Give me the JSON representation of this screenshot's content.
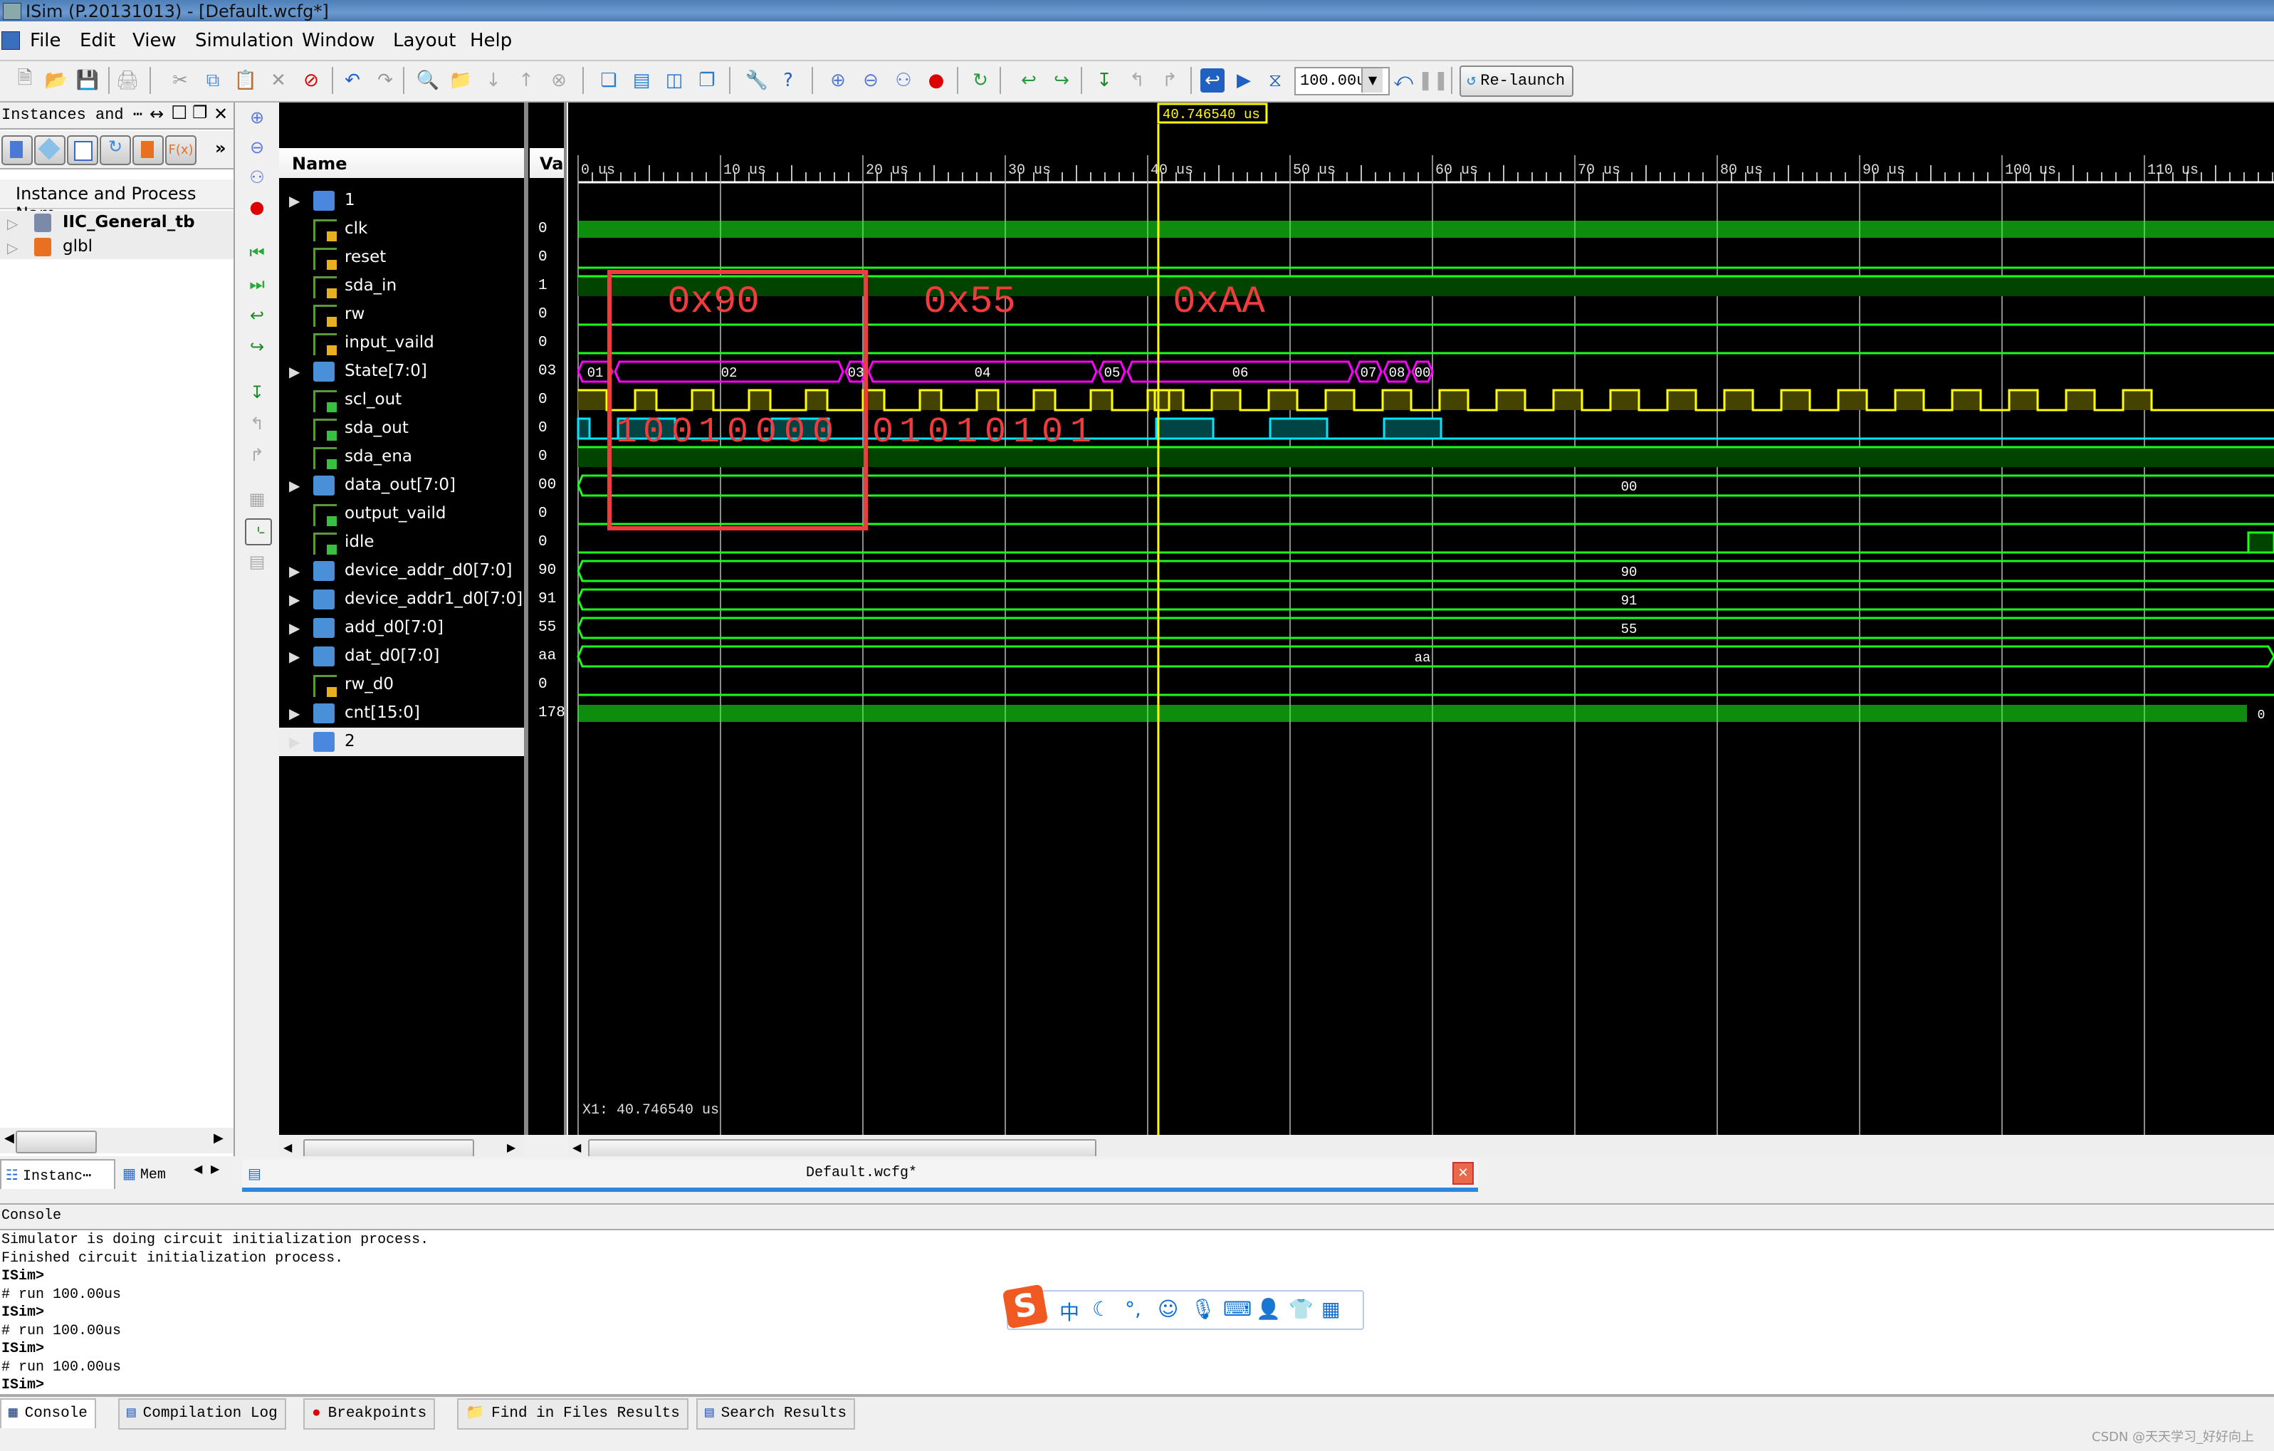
{
  "window": {
    "title": "ISim (P.20131013) - [Default.wcfg*]"
  },
  "menu": [
    "File",
    "Edit",
    "View",
    "Simulation",
    "Window",
    "Layout",
    "Help"
  ],
  "toolbar": {
    "icons": [
      "new-file-icon",
      "open-file-icon",
      "save-icon",
      "print-icon",
      "cut-icon",
      "copy-icon",
      "paste-icon",
      "delete-icon",
      "no-entry-icon",
      "undo-icon",
      "redo-icon",
      "find-icon",
      "find-in-files-icon",
      "arrow-down-icon",
      "arrow-up-icon",
      "stop-icon",
      "cascade-icon",
      "tile-horizontal-icon",
      "tile-vertical-icon",
      "float-window-icon",
      "wrench-icon",
      "context-help-icon",
      "zoom-in-icon",
      "zoom-out-icon",
      "zoom-fit-icon",
      "zoom-to-cursor-icon",
      "refresh-icon",
      "restart-icon",
      "run-icon",
      "step-icon",
      "step-back-icon",
      "step-forward-icon",
      "go-to-start-icon",
      "run-all-icon",
      "run-for-icon",
      "break-icon",
      "pause-icon"
    ],
    "run_time_value": "100.00u",
    "relaunch_label": "Re-launch"
  },
  "instances_panel": {
    "title": "Instances and ⋯",
    "header_controls": [
      "↔",
      "☐",
      "❐",
      "✕"
    ],
    "more_label": "»",
    "fx_label": "F(x)",
    "column_header": "Instance and Process Nam",
    "items": [
      {
        "label": "IIC_General_tb",
        "bold": true
      },
      {
        "label": "glbl",
        "bold": false
      }
    ]
  },
  "waveform": {
    "name_header": "Name",
    "value_header": "Va",
    "cursor_time": "40.746540 us",
    "x1_status": "X1: 40.746540 us",
    "signals": [
      {
        "name": "1",
        "value": "",
        "kind": "group"
      },
      {
        "name": "clk",
        "value": "0",
        "kind": "input"
      },
      {
        "name": "reset",
        "value": "0",
        "kind": "input"
      },
      {
        "name": "sda_in",
        "value": "1",
        "kind": "input"
      },
      {
        "name": "rw",
        "value": "0",
        "kind": "input"
      },
      {
        "name": "input_vaild",
        "value": "0",
        "kind": "input"
      },
      {
        "name": "State[7:0]",
        "value": "03",
        "kind": "bus"
      },
      {
        "name": "scl_out",
        "value": "0",
        "kind": "output"
      },
      {
        "name": "sda_out",
        "value": "0",
        "kind": "output"
      },
      {
        "name": "sda_ena",
        "value": "0",
        "kind": "output"
      },
      {
        "name": "data_out[7:0]",
        "value": "00",
        "kind": "busout"
      },
      {
        "name": "output_vaild",
        "value": "0",
        "kind": "output"
      },
      {
        "name": "idle",
        "value": "0",
        "kind": "output"
      },
      {
        "name": "device_addr_d0[7:0]",
        "value": "90",
        "kind": "bus"
      },
      {
        "name": "device_addr1_d0[7:0]",
        "value": "91",
        "kind": "bus"
      },
      {
        "name": "add_d0[7:0]",
        "value": "55",
        "kind": "bus"
      },
      {
        "name": "dat_d0[7:0]",
        "value": "aa",
        "kind": "bus"
      },
      {
        "name": "rw_d0",
        "value": "0",
        "kind": "internal"
      },
      {
        "name": "cnt[15:0]",
        "value": "178",
        "kind": "bus"
      },
      {
        "name": "2",
        "value": "",
        "kind": "group",
        "selected": true
      }
    ],
    "ruler_ticks": [
      "0 us",
      "10 us",
      "20 us",
      "30 us",
      "40 us",
      "50 us",
      "60 us",
      "70 us",
      "80 us",
      "90 us",
      "100 us",
      "110 us"
    ],
    "state_segments": [
      {
        "label": "01",
        "start": 0.0,
        "end": 2.4
      },
      {
        "label": "02",
        "start": 2.6,
        "end": 18.6
      },
      {
        "label": "03",
        "start": 18.8,
        "end": 20.2
      },
      {
        "label": "04",
        "start": 20.4,
        "end": 36.4
      },
      {
        "label": "05",
        "start": 36.6,
        "end": 38.4
      },
      {
        "label": "06",
        "start": 38.6,
        "end": 54.4
      },
      {
        "label": "07",
        "start": 54.6,
        "end": 56.4
      },
      {
        "label": "08",
        "start": 56.6,
        "end": 58.4
      },
      {
        "label": "00",
        "start": 58.6,
        "end": 60
      }
    ],
    "data_out_label": "00",
    "device_addr_label": "90",
    "device_addr1_label": "91",
    "add_label": "55",
    "dat_label": "aa",
    "cnt_end_label": "0",
    "annotations": {
      "byte_labels": [
        "0x90",
        "0x55",
        "0xAA"
      ],
      "bits_first": [
        "1",
        "0",
        "0",
        "1",
        "0",
        "0",
        "0",
        "0"
      ],
      "bits_second": [
        "0",
        "1",
        "0",
        "1",
        "0",
        "1",
        "0",
        "1"
      ],
      "box_color": "#f03c3c"
    },
    "colors": {
      "bus": "#ff00ff",
      "scl": "#ffff00",
      "sda": "#00e5ff",
      "logic": "#1aff1a",
      "cursor": "#ffff00",
      "annotation": "#f03c3c"
    }
  },
  "left_bottom_tabs": [
    "Instanc⋯",
    "Mem"
  ],
  "doc_tab": {
    "label": "Default.wcfg*"
  },
  "console": {
    "title": "Console",
    "lines": [
      {
        "text": "Simulator is doing circuit initialization process.",
        "bold": false
      },
      {
        "text": "Finished circuit initialization process.",
        "bold": false
      },
      {
        "text": "ISim>",
        "bold": true
      },
      {
        "text": "# run 100.00us",
        "bold": false
      },
      {
        "text": "ISim>",
        "bold": true
      },
      {
        "text": "# run 100.00us",
        "bold": false
      },
      {
        "text": "ISim>",
        "bold": true
      },
      {
        "text": "# run 100.00us",
        "bold": false
      },
      {
        "text": "ISim>",
        "bold": true
      }
    ]
  },
  "bottom_tabs": [
    "Console",
    "Compilation Log",
    "Breakpoints",
    "Find in Files Results",
    "Search Results"
  ],
  "ime_bar": {
    "logo": "S",
    "items": [
      "中",
      "☾",
      "°,",
      "☺",
      "🎙",
      "⌨",
      "👤",
      "👕",
      "▦"
    ]
  },
  "watermark": "CSDN @天天学习_好好向上"
}
